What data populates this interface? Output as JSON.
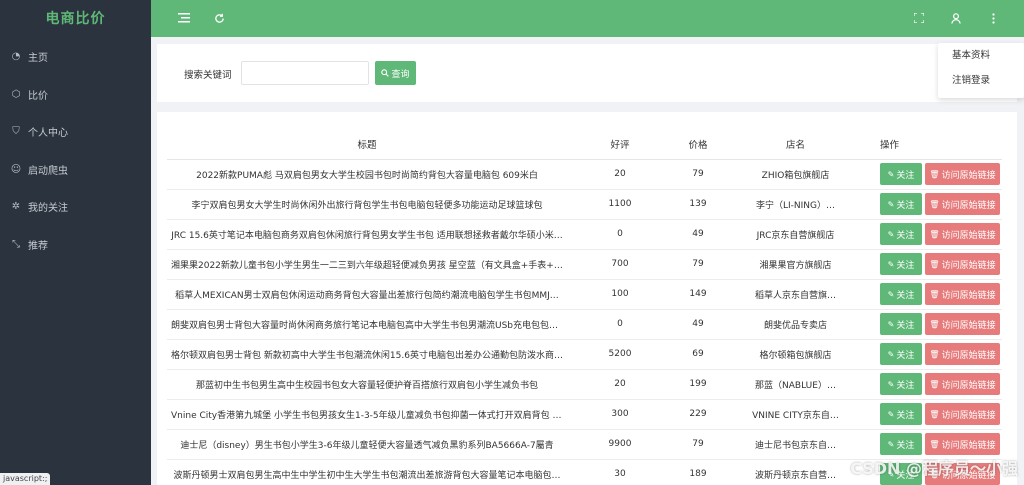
{
  "app": {
    "brand": "电商比价"
  },
  "sidebar": {
    "items": [
      {
        "label": "主页",
        "icon": "dashboard-icon",
        "glyph": "◔"
      },
      {
        "label": "比价",
        "icon": "cube-icon",
        "glyph": "⬡"
      },
      {
        "label": "个人中心",
        "icon": "shield-icon",
        "glyph": "⛉"
      },
      {
        "label": "启动爬虫",
        "icon": "smile-icon",
        "glyph": "☺"
      },
      {
        "label": "我的关注",
        "icon": "gear-icon",
        "glyph": "✲"
      },
      {
        "label": "推荐",
        "icon": "shrink-icon",
        "glyph": "⤡"
      }
    ]
  },
  "status_tip": "javascript:;",
  "header": {
    "dropdown": [
      "基本资料",
      "注销登录"
    ]
  },
  "search": {
    "label": "搜索关键词",
    "value": "",
    "placeholder": "",
    "button": "查询"
  },
  "table": {
    "columns": [
      "标题",
      "好评",
      "价格",
      "店名",
      "操作"
    ],
    "follow_label": "关注",
    "visit_label": "访问原始链接",
    "rows": [
      {
        "title": "2022新款PUMA彪 马双肩包男女大学生校园书包时尚简约背包大容量电脑包 609米白",
        "good": "20",
        "price": "79",
        "shop": "ZHIO箱包旗舰店"
      },
      {
        "title": "李宁双肩包男女大学生时尚休闲外出旅行背包学生书包电脑包轻便多功能运动足球篮球包",
        "good": "1100",
        "price": "139",
        "shop": "李宁（LI-NING）…"
      },
      {
        "title": "JRC 15.6英寸笔记本电脑包商务双肩包休闲旅行背包男女学生书包 适用联想拯救者戴尔华硕小米…",
        "good": "0",
        "price": "49",
        "shop": "JRC京东自营旗舰店"
      },
      {
        "title": "湘果果2022新款儿童书包小学生男生一二三到六年级超轻便减负男孩 星空蓝（有文具盒+手表+大…",
        "good": "700",
        "price": "79",
        "shop": "湘果果官方旗舰店"
      },
      {
        "title": "稻草人MEXICAN男士双肩包休闲运动商务背包大容量出差旅行包简约潮流电脑包学生书包MMJ…",
        "good": "100",
        "price": "149",
        "shop": "稻草人京东自营旗…"
      },
      {
        "title": "朗斐双肩包男士背包大容量时尚休闲商务旅行笔记本电脑包高中大学生书包男潮流USb充电包包6…",
        "good": "0",
        "price": "49",
        "shop": "朗斐优品专卖店"
      },
      {
        "title": "格尔顿双肩包男士背包 新款初高中大学生书包潮流休闲15.6英寸电脑包出差办公通勤包防泼水商…",
        "good": "5200",
        "price": "69",
        "shop": "格尔顿箱包旗舰店"
      },
      {
        "title": "那蓝初中生书包男生高中生校园书包女大容量轻便护脊百搭旅行双肩包小学生减负书包",
        "good": "20",
        "price": "199",
        "shop": "那蓝（NABLUE）…"
      },
      {
        "title": "Vnine City香港第九城堡 小学生书包男孩女生1-3-5年级儿童减负书包抑菌一体式打开双肩背包 宇…",
        "good": "300",
        "price": "229",
        "shop": "VNINE CITY京东自…"
      },
      {
        "title": "迪士尼（disney）男生书包小学生3-6年级儿童轻便大容量透气减负黑豹系列BA5666A-7屬青",
        "good": "9900",
        "price": "79",
        "shop": "迪士尼书包京东自…"
      },
      {
        "title": "波斯丹顿男士双肩包男生高中生中学生初中生大学生书包潮流出差旅游背包大容量笔记本电脑包…",
        "good": "30",
        "price": "189",
        "shop": "波斯丹顿京东自营…"
      }
    ]
  },
  "watermark": "CSDN @程序员～小强",
  "colors": {
    "accent": "#5fb878",
    "danger": "#e77b7b",
    "sidebar": "#2b333e"
  }
}
